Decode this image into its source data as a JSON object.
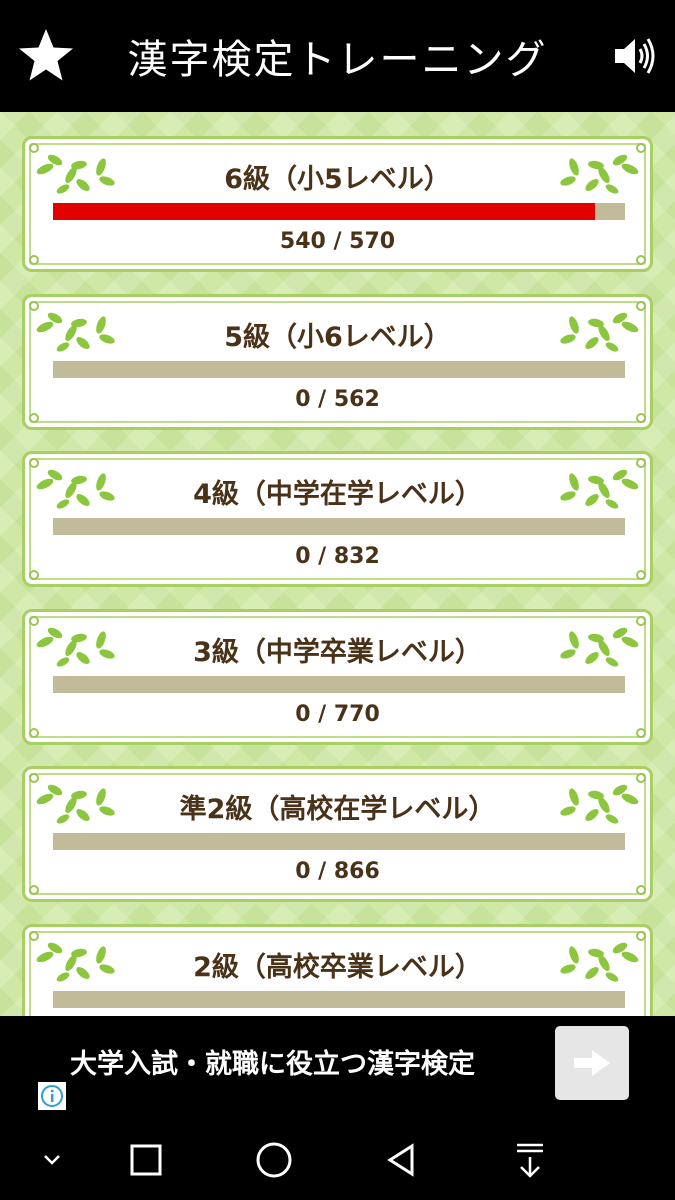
{
  "header": {
    "title": "漢字検定トレーニング",
    "left_icon": "star-icon",
    "right_icon": "speaker-icon"
  },
  "levels": [
    {
      "title": "6級（小5レベル）",
      "done": 540,
      "total": 570,
      "count_text": "540 / 570",
      "progress": 0.947
    },
    {
      "title": "5級（小6レベル）",
      "done": 0,
      "total": 562,
      "count_text": "0 / 562",
      "progress": 0
    },
    {
      "title": "4級（中学在学レベル）",
      "done": 0,
      "total": 832,
      "count_text": "0 / 832",
      "progress": 0
    },
    {
      "title": "3級（中学卒業レベル）",
      "done": 0,
      "total": 770,
      "count_text": "0 / 770",
      "progress": 0
    },
    {
      "title": "準2級（高校在学レベル）",
      "done": 0,
      "total": 866,
      "count_text": "0 / 866",
      "progress": 0
    },
    {
      "title": "2級（高校卒業レベル）",
      "done": 0,
      "total": null,
      "count_text": "",
      "progress": 0
    }
  ],
  "ad": {
    "text": "大学入試・就職に役立つ漢字検定",
    "button_icon": "arrow-right-icon",
    "info_icon": "info-icon"
  },
  "navbar": {
    "icons": [
      "chevron-down-icon",
      "recents-square-icon",
      "home-circle-icon",
      "back-triangle-icon",
      "download-icon"
    ]
  },
  "colors": {
    "progress_fill": "#e30000",
    "progress_track": "#c2bb9a",
    "card_border": "#a7cf61",
    "text": "#4a3219",
    "background": "#cfe8a6"
  }
}
